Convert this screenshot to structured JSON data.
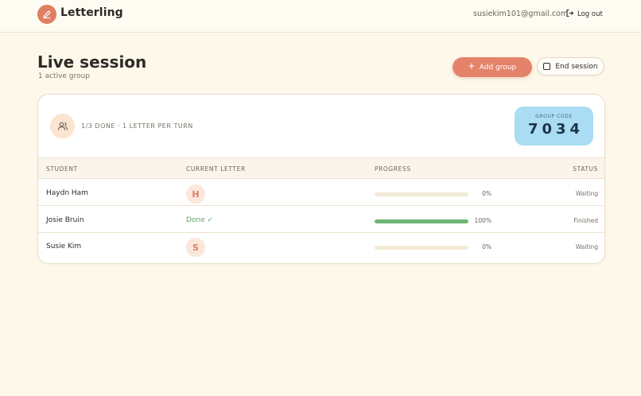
{
  "header": {
    "brand": "Letterling",
    "email": "susiekim101@gmail.com",
    "logout_label": "Log out",
    "logo_icon": "pencil-icon",
    "logout_icon": "logout-icon"
  },
  "page": {
    "title": "Live session",
    "subtitle": "1 active group",
    "add_group_label": "Add group",
    "end_session_label": "End session"
  },
  "group": {
    "status_text": "1/3 DONE · 1 LETTER PER TURN",
    "code_label": "GROUP CODE",
    "code": "7034",
    "icon": "users-icon"
  },
  "table": {
    "headers": {
      "student": "STUDENT",
      "current_letter": "CURRENT LETTER",
      "progress": "PROGRESS",
      "status": "STATUS"
    },
    "rows": [
      {
        "student": "Haydn Ham",
        "letter": "H",
        "done": false,
        "progress": 0,
        "progress_label": "0%",
        "status": "Waiting"
      },
      {
        "student": "Josie Bruin",
        "letter": "",
        "done": true,
        "done_label": "Done ✓",
        "progress": 100,
        "progress_label": "100%",
        "status": "Finished"
      },
      {
        "student": "Susie Kim",
        "letter": "S",
        "done": false,
        "progress": 0,
        "progress_label": "0%",
        "status": "Waiting"
      }
    ]
  },
  "colors": {
    "accent": "#e5826a",
    "background": "#fdf8ea",
    "code_box": "#aadcf4",
    "progress_fill": "#6bb672",
    "done_text": "#5aa868"
  }
}
